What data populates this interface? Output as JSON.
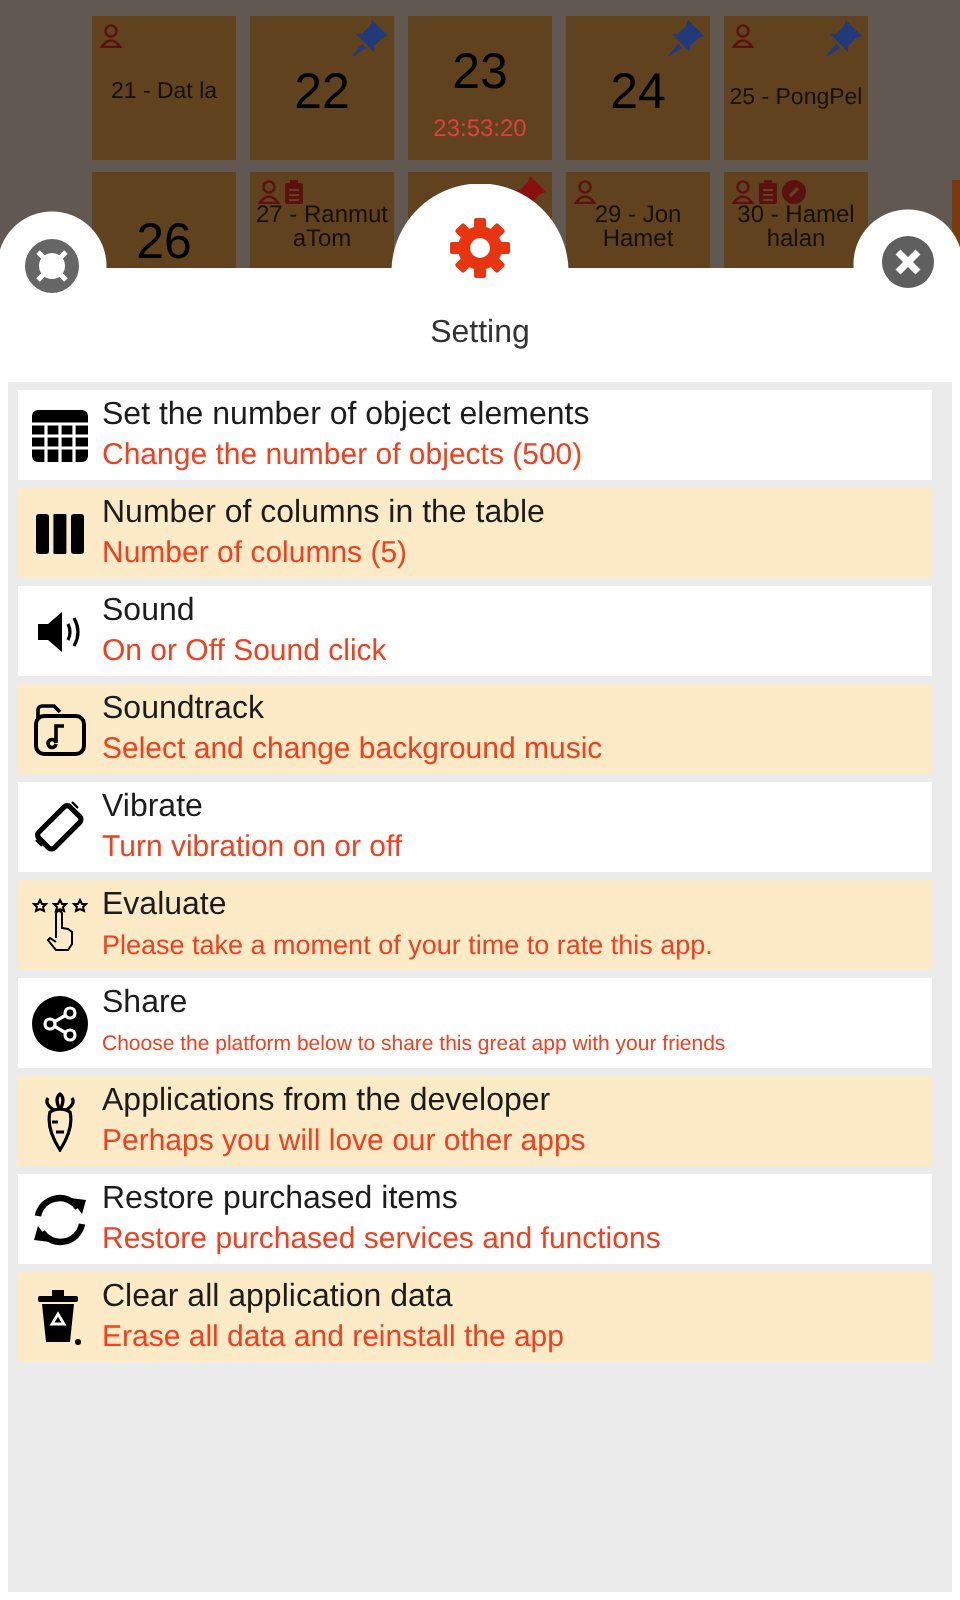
{
  "tiles": [
    {
      "label": "21 - Dat la",
      "kind": "name",
      "person": true,
      "note": false,
      "link": false,
      "pinned": false
    },
    {
      "label": "22",
      "kind": "number",
      "person": false,
      "note": false,
      "link": false,
      "pinned": true,
      "color": "#233a7a"
    },
    {
      "label": "23",
      "kind": "number",
      "person": false,
      "note": false,
      "link": false,
      "pinned": false,
      "time": "23:53:20"
    },
    {
      "label": "24",
      "kind": "number",
      "person": false,
      "note": false,
      "link": false,
      "pinned": true,
      "color": "#233a7a"
    },
    {
      "label": "25 - PongPel",
      "kind": "name",
      "person": true,
      "note": false,
      "link": false,
      "pinned": true,
      "color": "#233a7a"
    },
    {
      "label": "26",
      "kind": "number",
      "person": false,
      "note": false,
      "link": false,
      "pinned": false
    },
    {
      "label": "27 - Ranmut aTom",
      "kind": "name",
      "person": true,
      "note": true,
      "link": false,
      "pinned": false
    },
    {
      "person": false,
      "note": false,
      "link": false,
      "pinned": true,
      "color": "#8a1010"
    },
    {
      "label": "29 - Jon Hamet",
      "kind": "name",
      "person": true,
      "note": false,
      "link": false,
      "pinned": false
    },
    {
      "label": "30 - Hamel halan",
      "kind": "name",
      "person": true,
      "note": true,
      "link": true,
      "pinned": false
    }
  ],
  "sheet": {
    "title": "Setting"
  },
  "settings": [
    {
      "title": "Set the number of object elements",
      "subtitle": "Change the number of objects (500)"
    },
    {
      "title": "Number of columns in the table",
      "subtitle": "Number of columns (5)"
    },
    {
      "title": "Sound",
      "subtitle": "On or Off Sound click"
    },
    {
      "title": "Soundtrack",
      "subtitle": "Select and change background music"
    },
    {
      "title": "Vibrate",
      "subtitle": "Turn vibration on or off"
    },
    {
      "title": "Evaluate",
      "subtitle": "Please take a moment of your time to rate this app."
    },
    {
      "title": "Share",
      "subtitle": "Choose the platform below to share this great app with your friends"
    },
    {
      "title": "Applications from the developer",
      "subtitle": "Perhaps you will love our other apps"
    },
    {
      "title": "Restore purchased items",
      "subtitle": "Restore purchased services and functions"
    },
    {
      "title": "Clear all application data",
      "subtitle": "Erase all data and reinstall the app"
    }
  ]
}
